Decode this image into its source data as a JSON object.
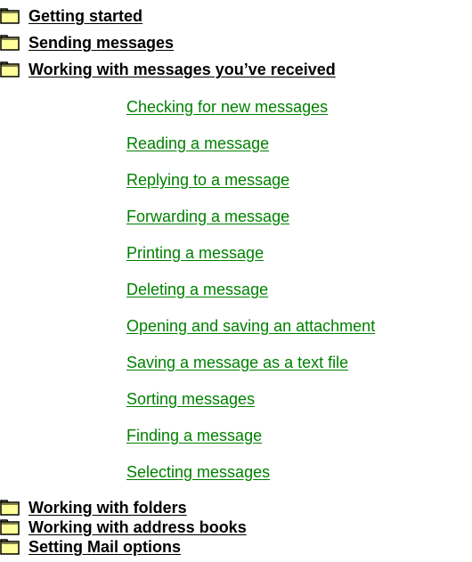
{
  "topics_top": [
    {
      "label": "Getting started",
      "icon": "folder-icon"
    },
    {
      "label": "Sending messages",
      "icon": "folder-icon"
    },
    {
      "label": "Working with messages you’ve received",
      "icon": "folder-icon"
    }
  ],
  "subtopics": [
    {
      "label": "Checking for new messages"
    },
    {
      "label": "Reading a message"
    },
    {
      "label": "Replying to a message"
    },
    {
      "label": "Forwarding a message"
    },
    {
      "label": "Printing a message"
    },
    {
      "label": "Deleting a message"
    },
    {
      "label": "Opening and saving an attachment"
    },
    {
      "label": "Saving a message as a text file"
    },
    {
      "label": "Sorting messages"
    },
    {
      "label": "Finding a message"
    },
    {
      "label": "Selecting messages"
    }
  ],
  "topics_bottom": [
    {
      "label": "Working with folders",
      "icon": "folder-icon"
    },
    {
      "label": "Working with address books",
      "icon": "folder-icon"
    },
    {
      "label": "Setting Mail options",
      "icon": "folder-icon"
    }
  ],
  "colors": {
    "link_green": "#008000",
    "topic_text": "#000000",
    "folder_fill": "#ffff99",
    "folder_stroke": "#000000"
  }
}
